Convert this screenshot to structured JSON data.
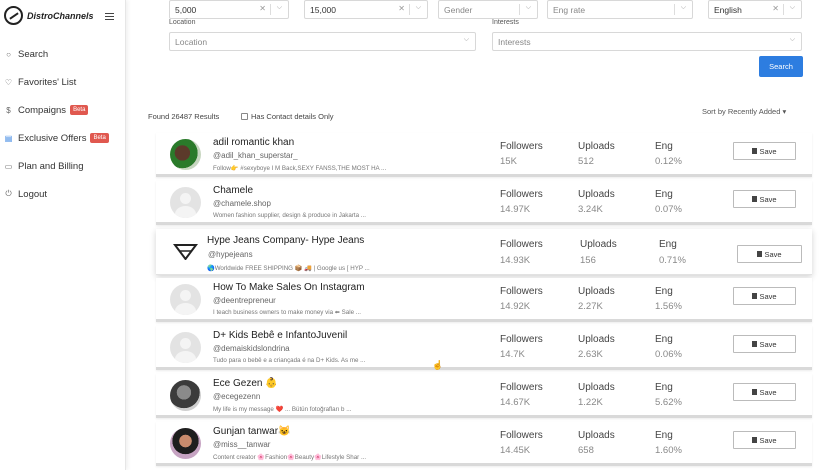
{
  "brand": {
    "name": "DistroChannels"
  },
  "nav": {
    "items": [
      {
        "icon": "search-icon",
        "glyph": "○",
        "label": "Search",
        "badge": ""
      },
      {
        "icon": "heart-icon",
        "glyph": "♡",
        "label": "Favorites' List",
        "badge": ""
      },
      {
        "icon": "dollar-icon",
        "glyph": "$",
        "label": "Compaigns",
        "badge": "Beta"
      },
      {
        "icon": "store-icon",
        "glyph": "▤",
        "label": "Exclusive Offers",
        "badge": "Beta"
      },
      {
        "icon": "card-icon",
        "glyph": "▭",
        "label": "Plan and Billing",
        "badge": ""
      },
      {
        "icon": "power-icon",
        "glyph": "⏻",
        "label": "Logout",
        "badge": ""
      }
    ]
  },
  "filters": {
    "min_followers": "5,000",
    "max_followers": "15,000",
    "gender_placeholder": "Gender",
    "eng_rate_placeholder": "Eng rate",
    "language": "English",
    "location_label": "Location",
    "location_placeholder": "Location",
    "interests_label": "Interests",
    "interests_placeholder": "Interests",
    "search_button": "Search"
  },
  "results": {
    "found": "Found 26487 Results",
    "contact_only": "Has Contact details Only",
    "sort": "Sort by Recently Added"
  },
  "labels": {
    "followers": "Followers",
    "uploads": "Uploads",
    "eng": "Eng",
    "save": "Save"
  },
  "influencers": [
    {
      "name": "adil romantic khan",
      "handle": "@adil_khan_superstar_",
      "bio": "Follow👉 #sexyboye I M Back,SEXY FANSS,THE MOST HA ...",
      "followers": "15K",
      "uploads": "512",
      "eng": "0.12%"
    },
    {
      "name": "Chamele",
      "handle": "@chamele.shop",
      "bio": "Women fashion supplier, design & produce in Jakarta ...",
      "followers": "14.97K",
      "uploads": "3.24K",
      "eng": "0.07%"
    },
    {
      "name": "Hype Jeans Company- Hype Jeans",
      "handle": "@hypejeans",
      "bio": "🌎Worldwide FREE SHIPPING 📦 🚚 | Google us [ HYP ...",
      "followers": "14.93K",
      "uploads": "156",
      "eng": "0.71%"
    },
    {
      "name": "How To Make Sales On Instagram",
      "handle": "@deentrepreneur",
      "bio": "I teach business owners to make money via ⬅ Sale ...",
      "followers": "14.92K",
      "uploads": "2.27K",
      "eng": "1.56%"
    },
    {
      "name": "D+ Kids Bebê e InfantoJuvenil",
      "handle": "@demaiskidslondrina",
      "bio": "Tudo para o bebê e a criançada é na D+ Kids. As me ...",
      "followers": "14.7K",
      "uploads": "2.63K",
      "eng": "0.06%"
    },
    {
      "name": "Ece Gezen 👶",
      "handle": "@ecegezenn",
      "bio": "My life is my message ❤️ ... Bütün fotoğrafları b ...",
      "followers": "14.67K",
      "uploads": "1.22K",
      "eng": "5.62%"
    },
    {
      "name": "Gunjan tanwar😺",
      "handle": "@miss__tanwar",
      "bio": "Content creator 🌸Fashion🌸Beauty🌸Lifestyle Shar ...",
      "followers": "14.45K",
      "uploads": "658",
      "eng": "1.60%"
    }
  ]
}
